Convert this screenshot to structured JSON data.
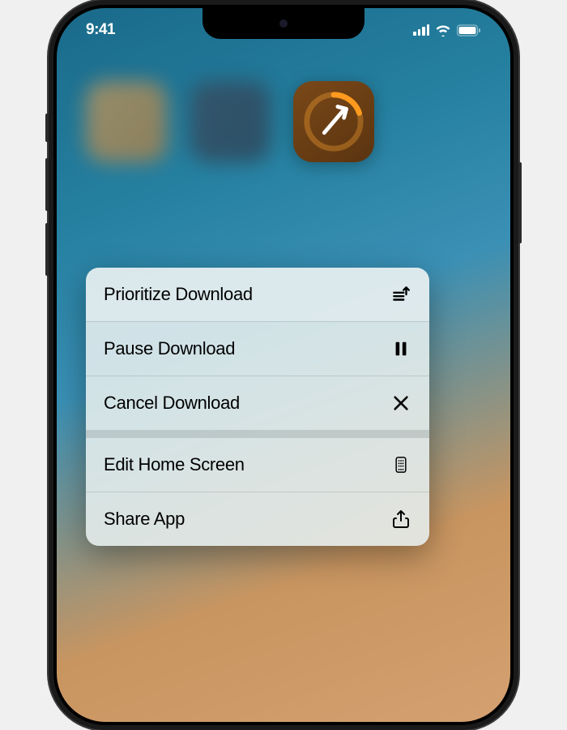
{
  "status": {
    "time": "9:41"
  },
  "menu": {
    "items": [
      {
        "label": "Prioritize Download",
        "icon": "prioritize-icon",
        "highlighted": true
      },
      {
        "label": "Pause Download",
        "icon": "pause-icon"
      },
      {
        "label": "Cancel Download",
        "icon": "x-icon"
      },
      {
        "label": "Edit Home Screen",
        "icon": "phone-grid-icon",
        "separator_before": true
      },
      {
        "label": "Share App",
        "icon": "share-icon"
      }
    ]
  },
  "app": {
    "download_progress": 0.2
  }
}
